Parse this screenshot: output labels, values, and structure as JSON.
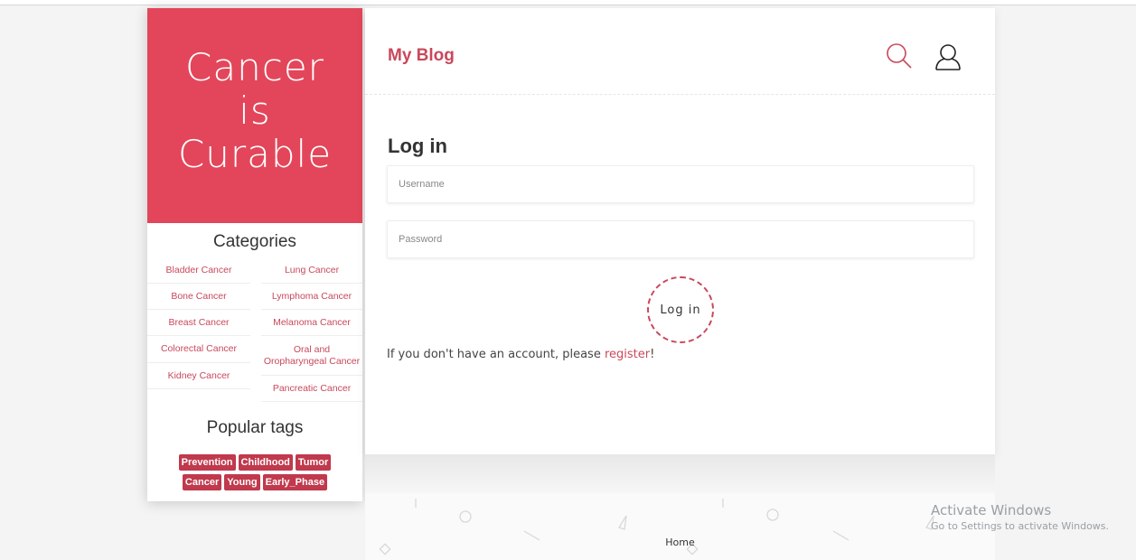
{
  "sidebar": {
    "brand": {
      "line1": "Cancer",
      "line2": "is",
      "line3": "Curable"
    },
    "categories_title": "Categories",
    "categories_left": [
      "Bladder Cancer",
      "Bone Cancer",
      "Breast Cancer",
      "Colorectal Cancer",
      "Kidney Cancer"
    ],
    "categories_right": [
      "Lung Cancer",
      "Lymphoma Cancer",
      "Melanoma Cancer",
      "Oral and Oropharyngeal Cancer",
      "Pancreatic Cancer"
    ],
    "tags_title": "Popular tags",
    "tags": [
      "Prevention",
      "Childhood",
      "Tumor",
      "Cancer",
      "Young",
      "Early_Phase"
    ]
  },
  "header": {
    "blog_title": "My Blog",
    "search_icon": "search-icon",
    "user_icon": "user-icon"
  },
  "login": {
    "title": "Log in",
    "username_placeholder": "Username",
    "password_placeholder": "Password",
    "button": "Log in",
    "register_prefix": "If you don't have an account, please ",
    "register_link": "register",
    "register_suffix": "!"
  },
  "footer": {
    "home": "Home"
  },
  "watermark": {
    "line1": "Activate Windows",
    "line2": "Go to Settings to activate Windows."
  },
  "colors": {
    "accent": "#e3465a",
    "link": "#c9485b",
    "tag": "#c0394d"
  }
}
